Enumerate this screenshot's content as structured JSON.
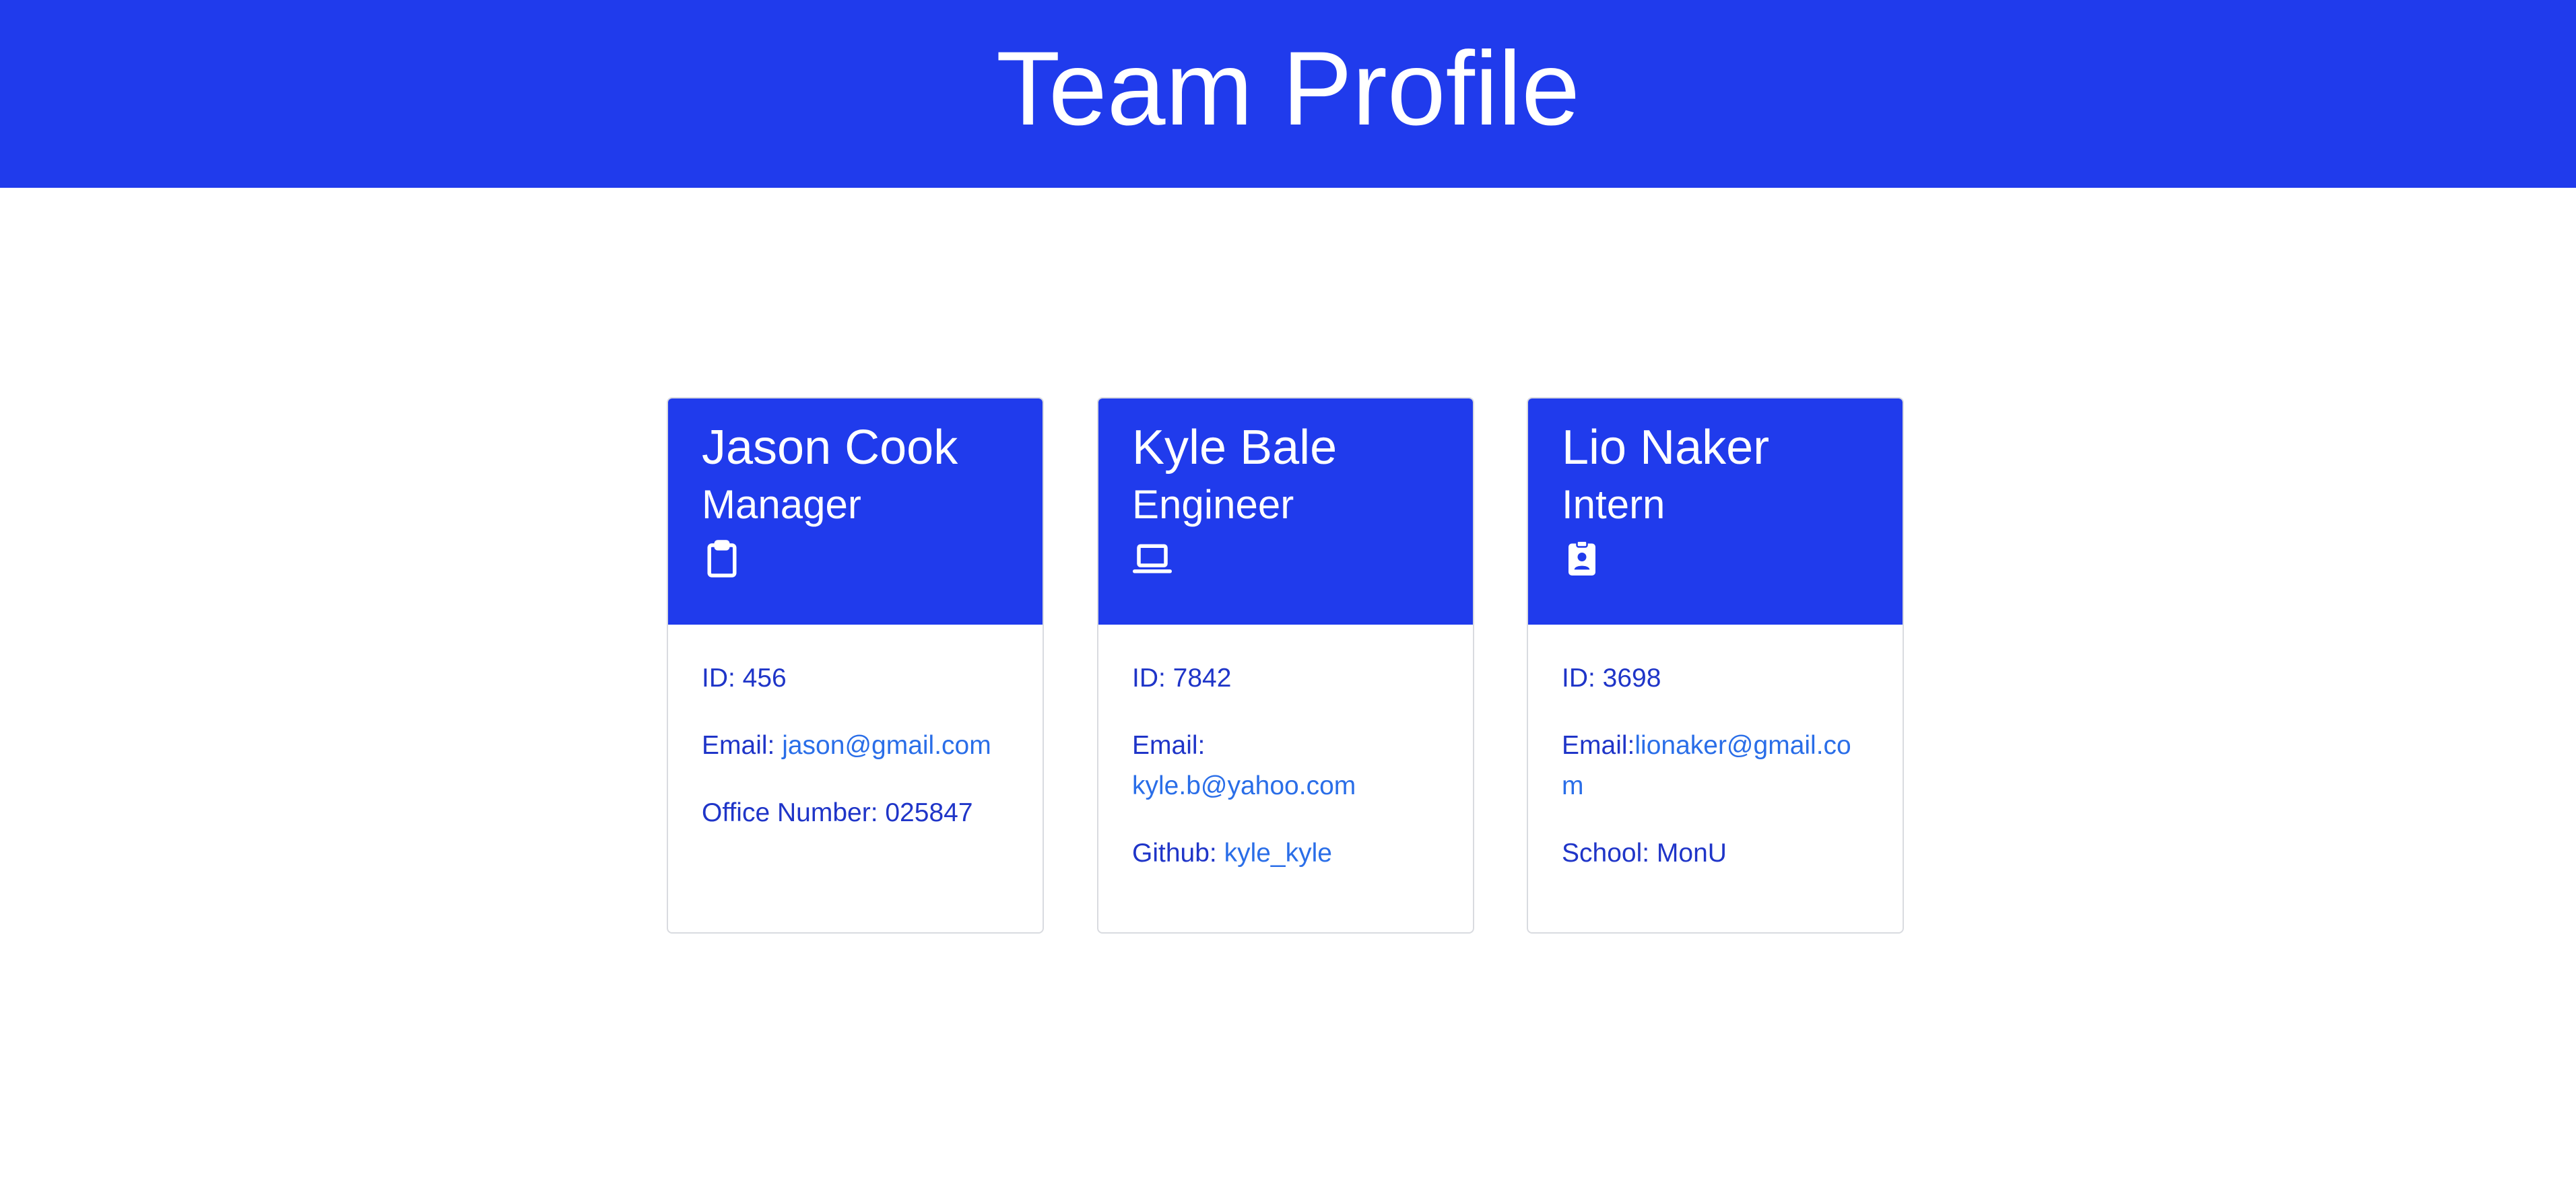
{
  "header": {
    "title": "Team Profile"
  },
  "colors": {
    "brand": "#203bec",
    "text": "#1f35c8",
    "link": "#2a6ee8",
    "card_border": "#d9dbe0"
  },
  "cards": [
    {
      "name": "Jason Cook",
      "role": "Manager",
      "icon": "clipboard-icon",
      "id_label": "ID: 456",
      "email_label": "Email: ",
      "email": "jason@gmail.com",
      "extra_label": "Office Number: 025847",
      "extra_value": ""
    },
    {
      "name": "Kyle Bale",
      "role": "Engineer",
      "icon": "laptop-icon",
      "id_label": "ID: 7842",
      "email_label": "Email: ",
      "email": "kyle.b@yahoo.com",
      "extra_label": "Github: ",
      "extra_value": "kyle_kyle"
    },
    {
      "name": "Lio Naker",
      "role": "Intern",
      "icon": "id-badge-icon",
      "id_label": "ID: 3698",
      "email_label": "Email:",
      "email": "lionaker@gmail.com",
      "extra_label": "School: MonU",
      "extra_value": ""
    }
  ]
}
